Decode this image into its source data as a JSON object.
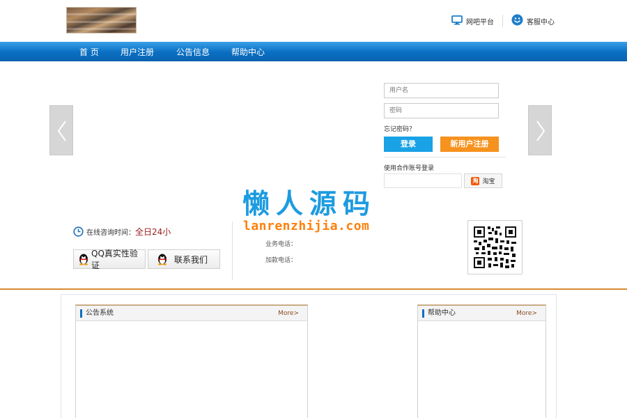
{
  "header": {
    "links": [
      {
        "label": "网吧平台",
        "icon": "monitor-icon"
      },
      {
        "label": "客服中心",
        "icon": "smiley-icon"
      }
    ]
  },
  "nav": {
    "items": [
      "首 页",
      "用户注册",
      "公告信息",
      "帮助中心"
    ],
    "color": "#0a6fc2"
  },
  "login": {
    "username_placeholder": "用户名",
    "password_placeholder": "密码",
    "forgot": "忘记密码？",
    "login_button": "登录",
    "register_button": "新用户注册",
    "partner_login": "使用合作账号登录",
    "taobao": "淘宝",
    "login_color": "#19a2e6",
    "register_color": "#f6921e"
  },
  "watermark": {
    "title": "懒人源码",
    "url": "lanrenzhijia.com"
  },
  "consult": {
    "online_label": "在线咨询时间：",
    "online_time": "全日24小",
    "qq_verify": "QQ真实性验证",
    "contact_us": "联系我们",
    "business_phone": "业务电话：",
    "add_money_phone": "加款电话："
  },
  "panels": {
    "notice": {
      "title": "公告系统",
      "more": "More>"
    },
    "help": {
      "title": "帮助中心",
      "more": "More>"
    }
  }
}
